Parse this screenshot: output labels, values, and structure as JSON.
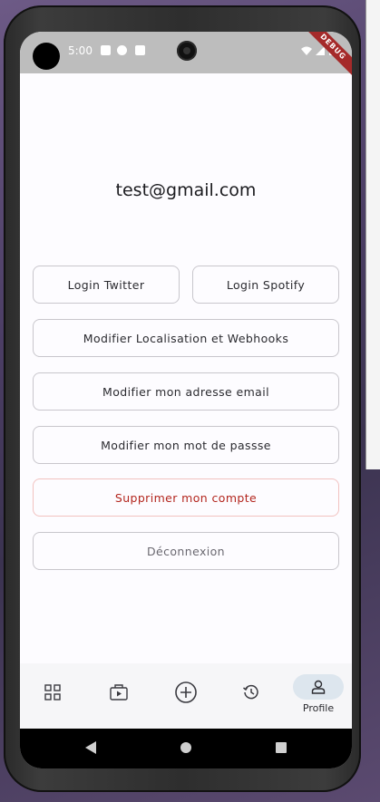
{
  "status": {
    "time": "5:00",
    "debug_banner": "DEBUG"
  },
  "profile": {
    "email": "test@gmail.com"
  },
  "actions": {
    "login_twitter": "Login Twitter",
    "login_spotify": "Login Spotify",
    "edit_location_webhooks": "Modifier Localisation et Webhooks",
    "edit_email": "Modifier mon adresse email",
    "edit_password": "Modifier mon mot de passse",
    "delete_account": "Supprimer mon compte",
    "logout": "Déconnexion"
  },
  "bottom_nav": {
    "items": [
      {
        "icon": "grid-icon"
      },
      {
        "icon": "play-folder-icon"
      },
      {
        "icon": "add-circle-icon"
      },
      {
        "icon": "history-icon"
      },
      {
        "icon": "profile-icon",
        "label": "Profile",
        "active": true
      }
    ]
  }
}
